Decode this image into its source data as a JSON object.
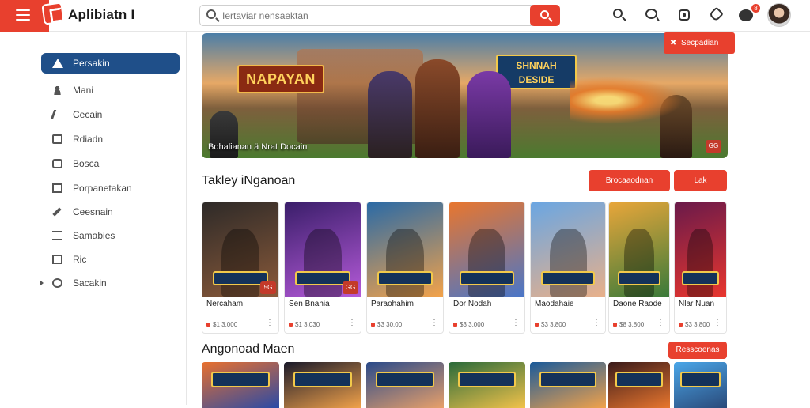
{
  "topbar": {
    "app_name": "Aplibiatn I",
    "search_placeholder": "Iertaviar nensaektan",
    "icons": [
      "search-icon",
      "chat-icon",
      "square-icon",
      "bell-icon",
      "gamepad-icon"
    ],
    "notification_count": "8"
  },
  "sidebar": {
    "items": [
      {
        "label": "Persakin",
        "icon": "triangle-icon",
        "active": true
      },
      {
        "label": "Mani",
        "icon": "people-icon"
      },
      {
        "label": "Cecain",
        "icon": "pen-icon"
      },
      {
        "label": "Rdiadn",
        "icon": "box-icon"
      },
      {
        "label": "Bosca",
        "icon": "camera-icon"
      },
      {
        "label": "Porpanetakan",
        "icon": "grid-icon"
      },
      {
        "label": "Ceesnain",
        "icon": "pencil-icon"
      },
      {
        "label": "Samabies",
        "icon": "list-icon"
      },
      {
        "label": "Ric",
        "icon": "grid-icon"
      },
      {
        "label": "Sacakin",
        "icon": "ring-icon"
      }
    ]
  },
  "hero": {
    "title_left": "NAPAYAN",
    "title_right": "SHNNAH DESIDE",
    "caption": "Bohalianan ä Nrat Docain",
    "corner_badge": "GG",
    "button_label": "Secpadian"
  },
  "section1": {
    "title": "Takley iNganoan",
    "btn_primary": "Brocaaodnan",
    "btn_secondary": "Lak"
  },
  "cards": [
    {
      "title": "Nercaham",
      "price": "$1 3.000",
      "badge": "5G",
      "colors": [
        "#2e2a28",
        "#8a5a3a"
      ]
    },
    {
      "title": "Sen Bnahia",
      "price": "$1 3.030",
      "badge": "GG",
      "colors": [
        "#3a1e6a",
        "#b45ad8"
      ]
    },
    {
      "title": "Paraohahim",
      "price": "$3 30.00",
      "badge": "",
      "colors": [
        "#2a6aa6",
        "#f2a24a"
      ]
    },
    {
      "title": "Dor Nodah",
      "price": "$3 3.000",
      "badge": "",
      "colors": [
        "#e8762e",
        "#4a76c8"
      ]
    },
    {
      "title": "Maodahaie",
      "price": "$3 3.800",
      "badge": "",
      "colors": [
        "#6aa6e2",
        "#e8b08a"
      ]
    },
    {
      "title": "Daone Raode",
      "price": "$8 3.800",
      "badge": "",
      "colors": [
        "#e8a63a",
        "#3a7a3a"
      ]
    },
    {
      "title": "Nlar Nuan",
      "price": "$3 3.800",
      "badge": "",
      "colors": [
        "#6a1a4a",
        "#e8362e"
      ]
    }
  ],
  "section2": {
    "title": "Angonoad Maen",
    "btn": "Resscoenas"
  },
  "cards2": [
    {
      "colors": [
        "#e8702e",
        "#2a4aa6"
      ]
    },
    {
      "colors": [
        "#1a1a2a",
        "#f2a24a"
      ]
    },
    {
      "colors": [
        "#2a4a8a",
        "#e8a06a"
      ]
    },
    {
      "colors": [
        "#2a6a3a",
        "#f2c24a"
      ]
    },
    {
      "colors": [
        "#1a5a9a",
        "#f2a24a"
      ]
    },
    {
      "colors": [
        "#3a1a1a",
        "#e8762e"
      ]
    },
    {
      "colors": [
        "#4aa6e8",
        "#2a4a7a"
      ]
    }
  ]
}
